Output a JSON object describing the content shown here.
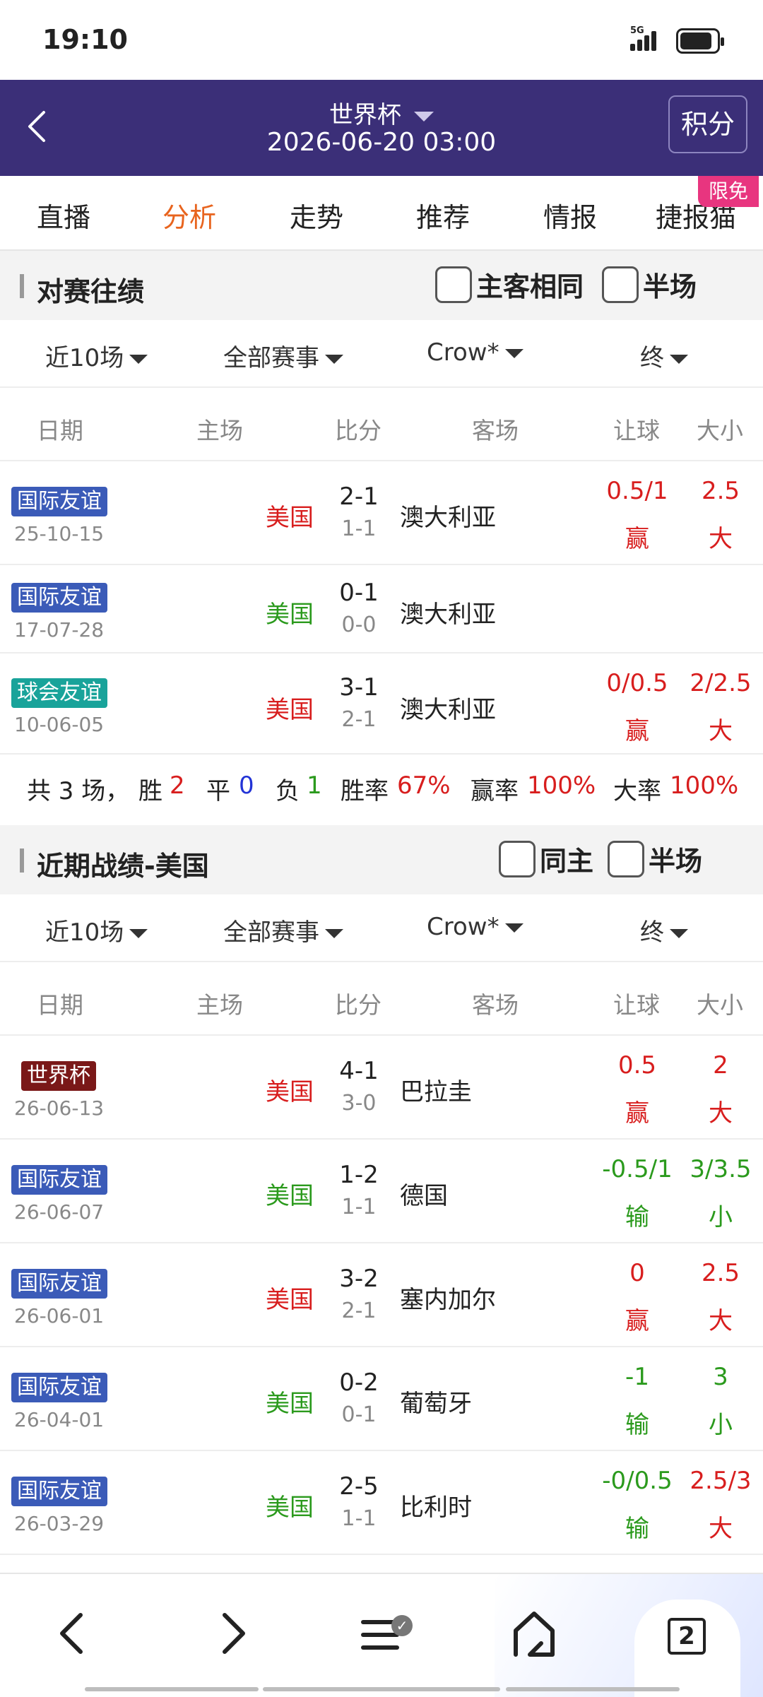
{
  "status_bar": {
    "time": "19:10",
    "network": "5G"
  },
  "header": {
    "title": "世界杯",
    "datetime": "2026-06-20 03:00",
    "points_label": "积分"
  },
  "tabs": [
    {
      "label": "直播"
    },
    {
      "label": "分析"
    },
    {
      "label": "走势"
    },
    {
      "label": "推荐"
    },
    {
      "label": "情报"
    },
    {
      "label": "捷报猫"
    }
  ],
  "tabs_badge": "限免",
  "h2h": {
    "title": "对赛往绩",
    "check_same": "主客相同",
    "check_half": "半场",
    "filters": {
      "range": "近10场",
      "competition": "全部赛事",
      "company": "Crow*",
      "period": "终"
    },
    "columns": {
      "date": "日期",
      "home": "主场",
      "score": "比分",
      "away": "客场",
      "handicap": "让球",
      "ou": "大小"
    },
    "rows": [
      {
        "competition": "国际友谊",
        "date": "25-10-15",
        "home": "美国",
        "score": "2-1",
        "half": "1-1",
        "away": "澳大利亚",
        "handicap": "0.5/1",
        "handicap_result": "赢",
        "ou": "2.5",
        "ou_result": "大"
      },
      {
        "competition": "国际友谊",
        "date": "17-07-28",
        "home": "美国",
        "score": "0-1",
        "half": "0-0",
        "away": "澳大利亚",
        "handicap": "",
        "handicap_result": "",
        "ou": "",
        "ou_result": ""
      },
      {
        "competition": "球会友谊",
        "date": "10-06-05",
        "home": "美国",
        "score": "3-1",
        "half": "2-1",
        "away": "澳大利亚",
        "handicap": "0/0.5",
        "handicap_result": "赢",
        "ou": "2/2.5",
        "ou_result": "大"
      }
    ],
    "summary": {
      "total": "共 3 场，",
      "win_label": "胜",
      "win": "2",
      "draw_label": "平",
      "draw": "0",
      "loss_label": "负",
      "loss": "1",
      "winrate_label": "胜率",
      "winrate": "67%",
      "handicap_rate_label": "赢率",
      "handicap_rate": "100%",
      "over_rate_label": "大率",
      "over_rate": "100%"
    }
  },
  "recent": {
    "title": "近期战绩-美国",
    "check_same": "同主",
    "check_half": "半场",
    "filters": {
      "range": "近10场",
      "competition": "全部赛事",
      "company": "Crow*",
      "period": "终"
    },
    "columns": {
      "date": "日期",
      "home": "主场",
      "score": "比分",
      "away": "客场",
      "handicap": "让球",
      "ou": "大小"
    },
    "rows": [
      {
        "competition": "世界杯",
        "date": "26-06-13",
        "home": "美国",
        "score": "4-1",
        "half": "3-0",
        "away": "巴拉圭",
        "handicap": "0.5",
        "handicap_result": "赢",
        "ou": "2",
        "ou_result": "大"
      },
      {
        "competition": "国际友谊",
        "date": "26-06-07",
        "home": "美国",
        "score": "1-2",
        "half": "1-1",
        "away": "德国",
        "handicap": "-0.5/1",
        "handicap_result": "输",
        "ou": "3/3.5",
        "ou_result": "小"
      },
      {
        "competition": "国际友谊",
        "date": "26-06-01",
        "home": "美国",
        "score": "3-2",
        "half": "2-1",
        "away": "塞内加尔",
        "handicap": "0",
        "handicap_result": "赢",
        "ou": "2.5",
        "ou_result": "大"
      },
      {
        "competition": "国际友谊",
        "date": "26-04-01",
        "home": "美国",
        "score": "0-2",
        "half": "0-1",
        "away": "葡萄牙",
        "handicap": "-1",
        "handicap_result": "输",
        "ou": "3",
        "ou_result": "小"
      },
      {
        "competition": "国际友谊",
        "date": "26-03-29",
        "home": "美国",
        "score": "2-5",
        "half": "1-1",
        "away": "比利时",
        "handicap": "-0/0.5",
        "handicap_result": "输",
        "ou": "2.5/3",
        "ou_result": "大"
      }
    ]
  },
  "bottom_nav": {
    "tab_count": "2"
  },
  "colors": {
    "header_bg": "#3b2f78",
    "active_tab": "#e8641e",
    "red": "#d81e1e",
    "green": "#2b9a1d",
    "blue": "#2233d6",
    "tag_blue": "#3b5bb8",
    "tag_teal": "#19a39a",
    "tag_worldcup": "#7a1818",
    "badge": "#e8357f"
  }
}
